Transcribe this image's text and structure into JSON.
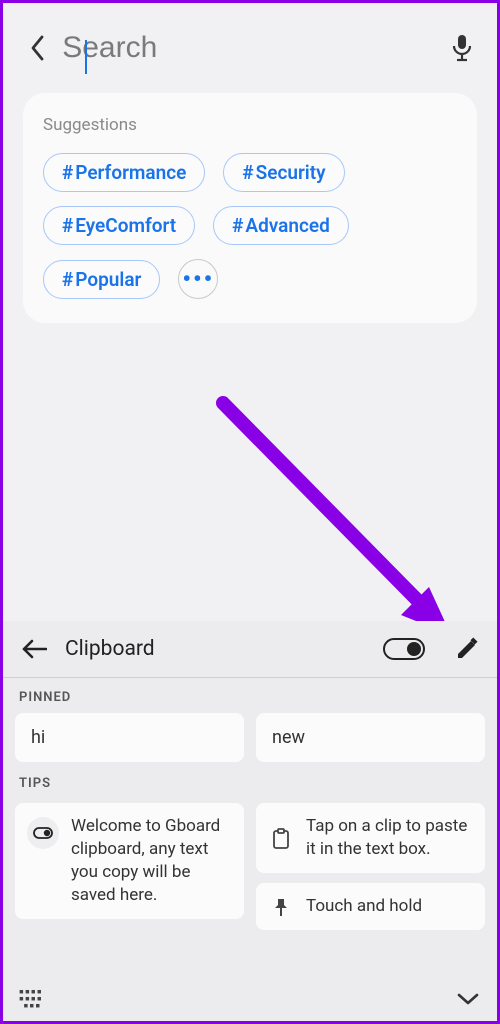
{
  "search": {
    "placeholder": "Search"
  },
  "suggestions": {
    "title": "Suggestions",
    "chips": [
      "Performance",
      "Security",
      "EyeComfort",
      "Advanced",
      "Popular"
    ]
  },
  "clipboard": {
    "title": "Clipboard",
    "sections": {
      "pinned": {
        "label": "PINNED",
        "items": [
          "hi",
          "new"
        ]
      },
      "tips": {
        "label": "TIPS",
        "items": [
          "Welcome to Gboard clipboard, any text you copy will be saved here.",
          "Tap on a clip to paste it in the text box.",
          "Touch and hold"
        ]
      }
    }
  }
}
